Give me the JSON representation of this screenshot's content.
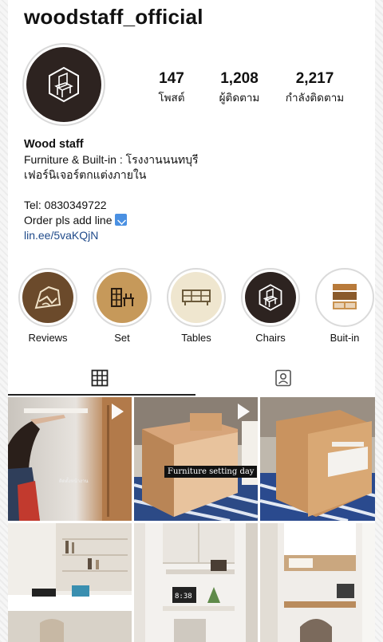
{
  "profile": {
    "username": "woodstaff_official",
    "stats": [
      {
        "value": "147",
        "label": "โพสต์"
      },
      {
        "value": "1,208",
        "label": "ผู้ติดตาม"
      },
      {
        "value": "2,217",
        "label": "กำลังติดตาม"
      }
    ],
    "bio": {
      "name": "Wood staff",
      "line1": "Furniture & Built-in : โรงงานนนทบุรี",
      "line2": "เฟอร์นิเจอร์ตกแต่งภายใน",
      "tel": "Tel: 0830349722",
      "order": "Order pls add line",
      "link": "lin.ee/5vaKQjN"
    }
  },
  "highlights": [
    {
      "label": "Reviews",
      "icon": "reviews-icon"
    },
    {
      "label": "Set",
      "icon": "furniture-set-icon"
    },
    {
      "label": "Tables",
      "icon": "tables-icon"
    },
    {
      "label": "Chairs",
      "icon": "chair-logo-icon"
    },
    {
      "label": "Buit-in",
      "icon": "builtin-cabinet-icon"
    }
  ],
  "tabs": [
    {
      "name": "grid",
      "icon": "grid-icon",
      "active": true
    },
    {
      "name": "tagged",
      "icon": "tagged-person-icon",
      "active": false
    }
  ],
  "posts": [
    {
      "type": "video",
      "overlay_text": "ติดตั้งหน้างาน"
    },
    {
      "type": "video",
      "caption": "Furniture setting day"
    },
    {
      "type": "image"
    },
    {
      "type": "image"
    },
    {
      "type": "image"
    },
    {
      "type": "image"
    }
  ],
  "colors": {
    "brand_dark": "#2d2320",
    "link": "#1f4a8a",
    "line_blue": "#4a90e2"
  }
}
